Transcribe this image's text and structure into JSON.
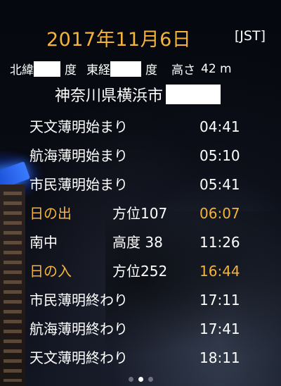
{
  "header": {
    "date": "2017年11月6日",
    "timezone": "[JST]"
  },
  "location": {
    "latitude_label": "北緯",
    "latitude_unit": "度",
    "longitude_label": "東経",
    "longitude_unit": "度",
    "altitude_label": "高さ",
    "altitude_value": "42 m",
    "city": "神奈川県横浜市"
  },
  "rows": [
    {
      "label": "天文薄明始まり",
      "info": "",
      "time": "04:41",
      "highlight": false
    },
    {
      "label": "航海薄明始まり",
      "info": "",
      "time": "05:10",
      "highlight": false
    },
    {
      "label": "市民薄明始まり",
      "info": "",
      "time": "05:41",
      "highlight": false
    },
    {
      "label": "日の出",
      "info": "方位107",
      "time": "06:07",
      "highlight": true
    },
    {
      "label": "南中",
      "info": "高度 38",
      "time": "11:26",
      "highlight": false
    },
    {
      "label": "日の入",
      "info": "方位252",
      "time": "16:44",
      "highlight": true
    },
    {
      "label": "市民薄明終わり",
      "info": "",
      "time": "17:11",
      "highlight": false
    },
    {
      "label": "航海薄明終わり",
      "info": "",
      "time": "17:41",
      "highlight": false
    },
    {
      "label": "天文薄明終わり",
      "info": "",
      "time": "18:11",
      "highlight": false
    }
  ],
  "pager": {
    "page_count": 3,
    "active_index": 1
  },
  "colors": {
    "accent": "#f6b33a",
    "text": "#ffffff",
    "mask": "#ffffff"
  }
}
